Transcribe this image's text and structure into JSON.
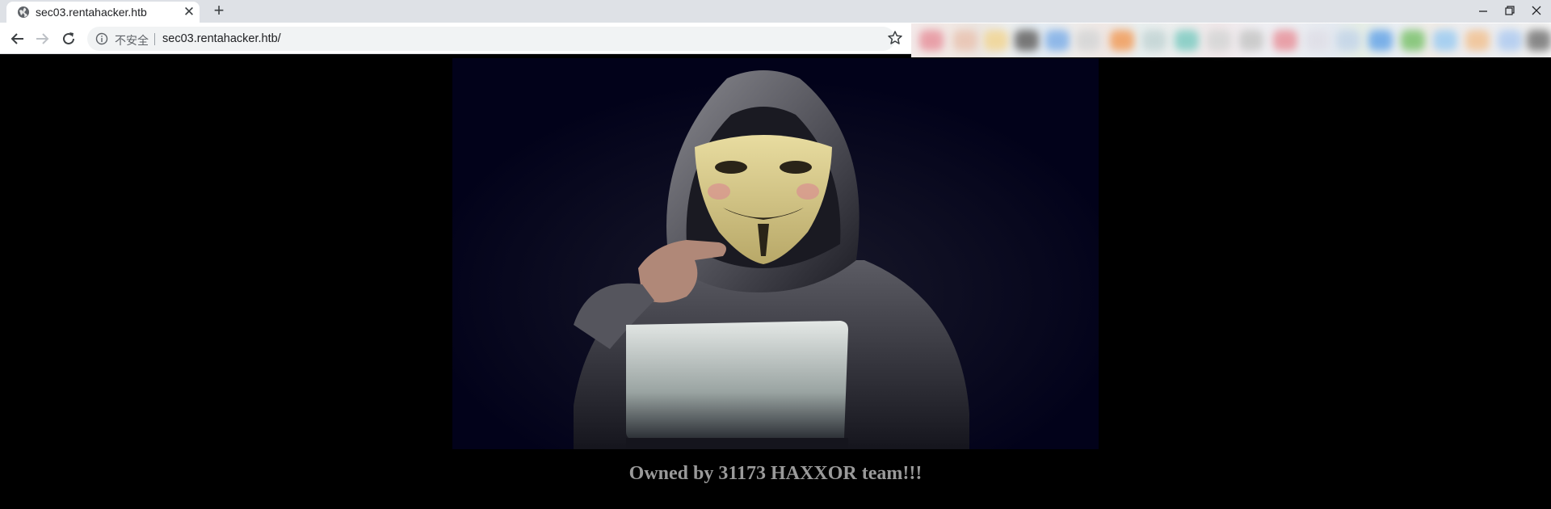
{
  "browser": {
    "tab": {
      "title": "sec03.rentahacker.htb",
      "favicon": "globe-icon"
    },
    "new_tab_symbol": "+",
    "close_symbol": "✕",
    "address_bar": {
      "security_label": "不安全",
      "url": "sec03.rentahacker.htb/"
    }
  },
  "page": {
    "background_color": "#000000",
    "hero_image": "hooded-hacker-guy-fawkes-mask-laptop",
    "caption": "Owned by 31173 HAXXOR team!!!",
    "caption_color": "#9a9a9a"
  }
}
